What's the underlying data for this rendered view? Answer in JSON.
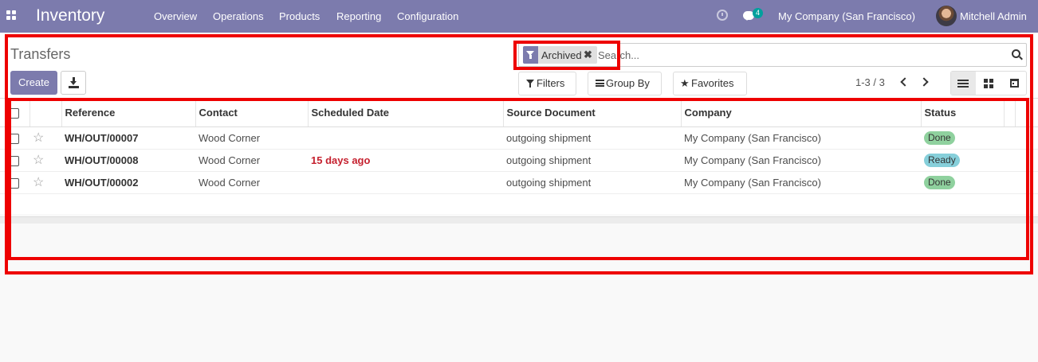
{
  "navbar": {
    "app_title": "Inventory",
    "menus": [
      "Overview",
      "Operations",
      "Products",
      "Reporting",
      "Configuration"
    ],
    "message_count": "4",
    "company": "My Company (San Francisco)",
    "user": "Mitchell Admin",
    "bg_color": "#7c7bad"
  },
  "control_panel": {
    "title": "Transfers",
    "create_label": "Create",
    "search": {
      "facet_label": "Archived",
      "facet_remove": "✖",
      "placeholder": "Search..."
    },
    "filters_label": "Filters",
    "groupby_label": "Group By",
    "favorites_label": "Favorites",
    "pager": "1-3 / 3",
    "active_view": "list"
  },
  "table": {
    "columns": [
      "Reference",
      "Contact",
      "Scheduled Date",
      "Source Document",
      "Company",
      "Status"
    ],
    "rows": [
      {
        "reference": "WH/OUT/00007",
        "contact": "Wood Corner",
        "scheduled_date": "",
        "source": "outgoing shipment",
        "company": "My Company (San Francisco)",
        "status": "Done",
        "status_color": "#8fd19e"
      },
      {
        "reference": "WH/OUT/00008",
        "contact": "Wood Corner",
        "scheduled_date": "15 days ago",
        "source": "outgoing shipment",
        "company": "My Company (San Francisco)",
        "status": "Ready",
        "status_color": "#86cfda"
      },
      {
        "reference": "WH/OUT/00002",
        "contact": "Wood Corner",
        "scheduled_date": "",
        "source": "outgoing shipment",
        "company": "My Company (San Francisco)",
        "status": "Done",
        "status_color": "#8fd19e"
      }
    ]
  },
  "annotation_color": "#ee0000"
}
